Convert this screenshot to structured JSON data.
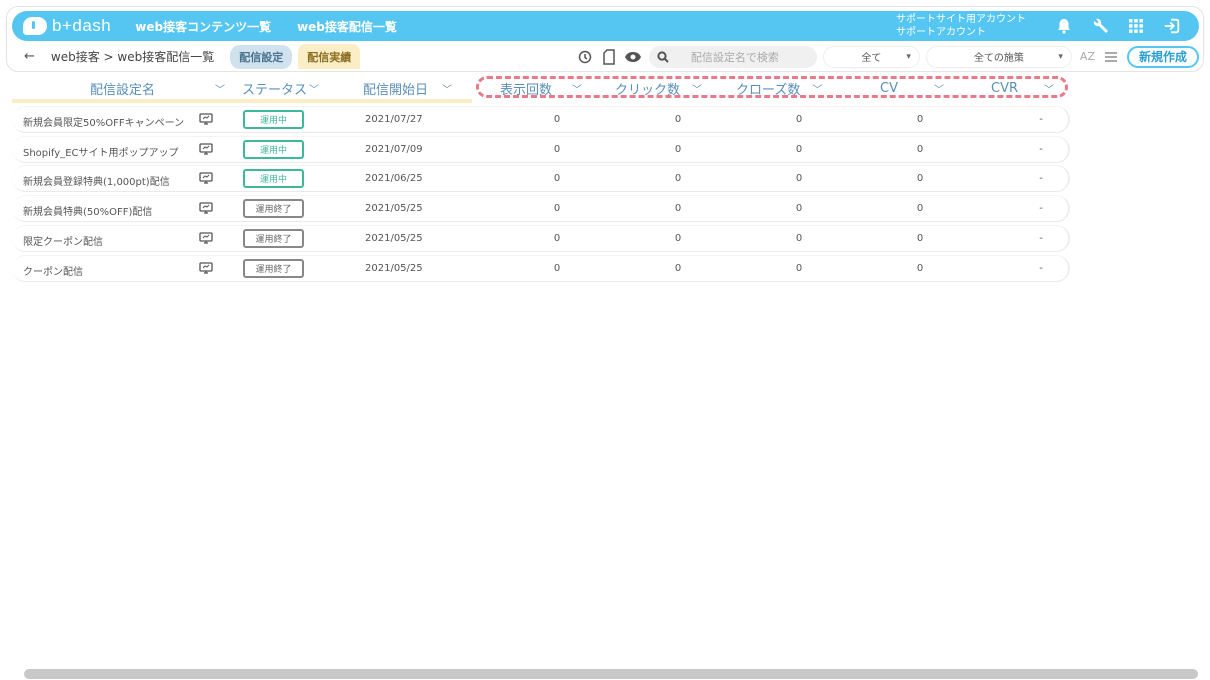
{
  "app": {
    "logo_text": "b+dash",
    "nav": [
      "web接客コンテンツ一覧",
      "web接客配信一覧"
    ],
    "account_line1": "サポートサイト用アカウント",
    "account_line2": "サポートアカウント"
  },
  "subbar": {
    "back": "←",
    "breadcrumb": "web接客 > web接客配信一覧",
    "tab_config": "配信設定",
    "tab_results": "配信実績",
    "search_placeholder": "配信設定名で検索",
    "filter_all": "全て",
    "filter_measures": "全ての施策",
    "sort_label": "AZ",
    "new_button": "新規作成"
  },
  "table": {
    "headers": {
      "name": "配信設定名",
      "status": "ステータス",
      "start": "配信開始日",
      "impressions": "表示回数",
      "clicks": "クリック数",
      "closes": "クローズ数",
      "cv": "CV",
      "cvr": "CVR"
    },
    "rows": [
      {
        "name": "新規会員限定50%OFFキャンペーン",
        "status": "運用中",
        "active": true,
        "date": "2021/07/27",
        "impressions": "0",
        "clicks": "0",
        "closes": "0",
        "cv": "0",
        "cvr": "-"
      },
      {
        "name": "Shopify_ECサイト用ポップアップ",
        "status": "運用中",
        "active": true,
        "date": "2021/07/09",
        "impressions": "0",
        "clicks": "0",
        "closes": "0",
        "cv": "0",
        "cvr": "-"
      },
      {
        "name": "新規会員登録特典(1,000pt)配信",
        "status": "運用中",
        "active": true,
        "date": "2021/06/25",
        "impressions": "0",
        "clicks": "0",
        "closes": "0",
        "cv": "0",
        "cvr": "-"
      },
      {
        "name": "新規会員特典(50%OFF)配信",
        "status": "運用終了",
        "active": false,
        "date": "2021/05/25",
        "impressions": "0",
        "clicks": "0",
        "closes": "0",
        "cv": "0",
        "cvr": "-"
      },
      {
        "name": "限定クーポン配信",
        "status": "運用終了",
        "active": false,
        "date": "2021/05/25",
        "impressions": "0",
        "clicks": "0",
        "closes": "0",
        "cv": "0",
        "cvr": "-"
      },
      {
        "name": "クーポン配信",
        "status": "運用終了",
        "active": false,
        "date": "2021/05/25",
        "impressions": "0",
        "clicks": "0",
        "closes": "0",
        "cv": "0",
        "cvr": "-"
      }
    ]
  },
  "colors": {
    "accent": "#55c6f2",
    "active": "#3fb89a",
    "highlight": "#e97a87"
  }
}
